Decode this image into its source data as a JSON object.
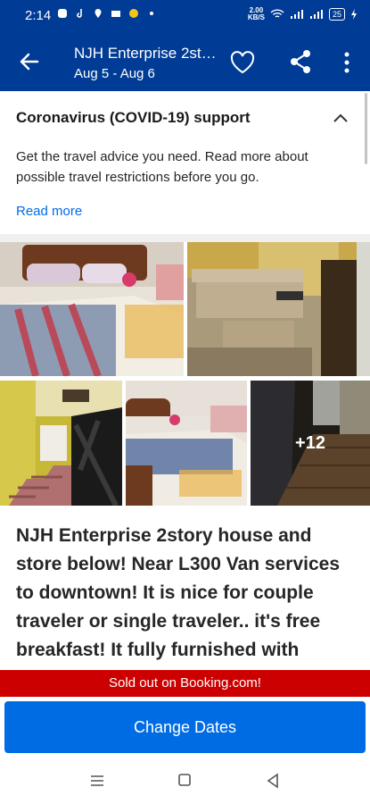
{
  "status_bar": {
    "time": "2:14",
    "net_speed_value": "2.00",
    "net_speed_unit": "KB/S",
    "battery": "25"
  },
  "header": {
    "title": "NJH Enterprise 2story house and store below! Near L300 Van services to downtown! It is nice for couple traveler or single traveler.. it's free breakfast! It fully furnished with",
    "dates": "Aug 5 - Aug 6",
    "icons": [
      "back-arrow-icon",
      "heart-icon",
      "share-icon",
      "more-vert-icon"
    ]
  },
  "covid": {
    "heading": "Coronavirus (COVID-19) support",
    "body": "Get the travel advice you need. Read more about possible travel restrictions before you go.",
    "link": "Read more"
  },
  "gallery": {
    "more_count": "+12",
    "photos": [
      "bedroom-photo",
      "desk-photo",
      "staircase-photo",
      "bedroom-photo-2",
      "hallway-photo"
    ]
  },
  "description": "NJH Enterprise 2story house and store below! Near L300 Van services to downtown! It is nice for couple traveler or single traveler.. it's free breakfast! It fully furnished with",
  "sold_out": "Sold out on Booking.com!",
  "cta": {
    "label": "Change Dates"
  },
  "colors": {
    "brand_blue": "#003b95",
    "action_blue": "#006ce4",
    "sold_out_red": "#cc0000"
  }
}
